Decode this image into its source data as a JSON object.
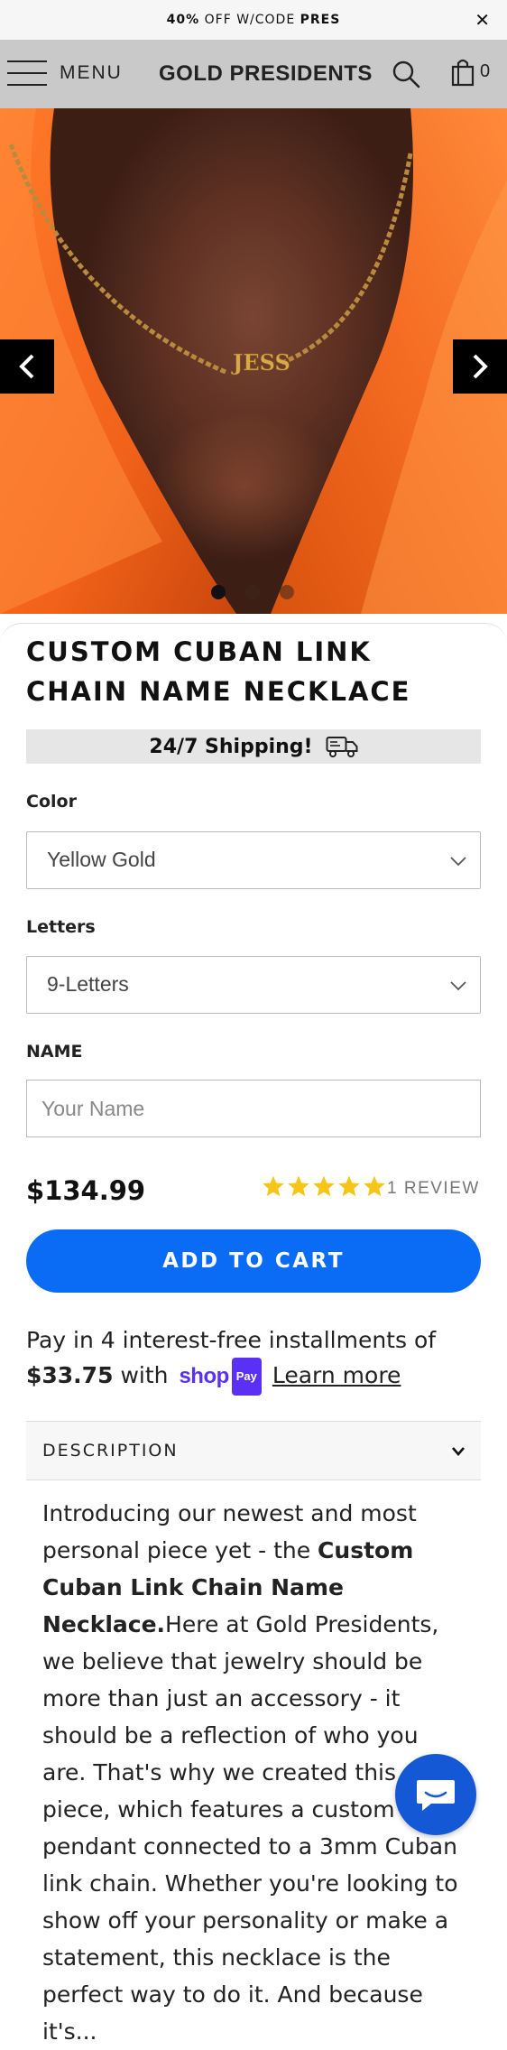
{
  "announcement": {
    "prefix": "40%",
    "middle": " OFF W/CODE ",
    "code": "PRES",
    "close_symbol": "✕"
  },
  "header": {
    "menu_label": "MENU",
    "logo": "GOLD PRESIDENTS",
    "cart_count": "0"
  },
  "gallery": {
    "slide_count": 3,
    "active_slide": 1
  },
  "product": {
    "title": "CUSTOM CUBAN LINK CHAIN NAME NECKLACE",
    "shipping_banner": "24/7 Shipping!",
    "color_label": "Color",
    "color_value": "Yellow Gold",
    "letters_label": "Letters",
    "letters_value": "9-Letters",
    "name_label": "NAME",
    "name_placeholder": "Your Name",
    "price": "$134.99",
    "rating_stars": 5,
    "review_text": "1 REVIEW",
    "add_to_cart": "ADD TO CART"
  },
  "installments": {
    "line1": "Pay in 4 interest-free installments of",
    "amount": "$33.75",
    "with": "with",
    "shop_word": "shop",
    "pay_badge": "Pay",
    "learn_more": "Learn more"
  },
  "description": {
    "header": "DESCRIPTION",
    "intro": "Introducing our newest and most personal piece yet - the ",
    "bold": "Custom Cuban Link Chain Name Necklace.",
    "body": "Here at Gold Presidents, we believe that jewelry should be more than just an accessory - it should be a reflection of who you are. That's why we created this piece, which features a custom name pendant connected to a 3mm Cuban link chain. Whether you're looking to show off your personality or make a statement, this necklace is the perfect way to do it. And because it's..."
  },
  "colors": {
    "accent": "#0a6cf5",
    "header_bg": "#c9c9c9",
    "shop_pay": "#5a31f4",
    "chat": "#1458d6",
    "star": "#f5c518"
  },
  "icons": {
    "menu": "hamburger-icon",
    "search": "search-icon",
    "cart": "cart-icon",
    "prev": "chevron-left-icon",
    "next": "chevron-right-icon",
    "truck": "truck-icon",
    "chat": "chat-icon"
  }
}
